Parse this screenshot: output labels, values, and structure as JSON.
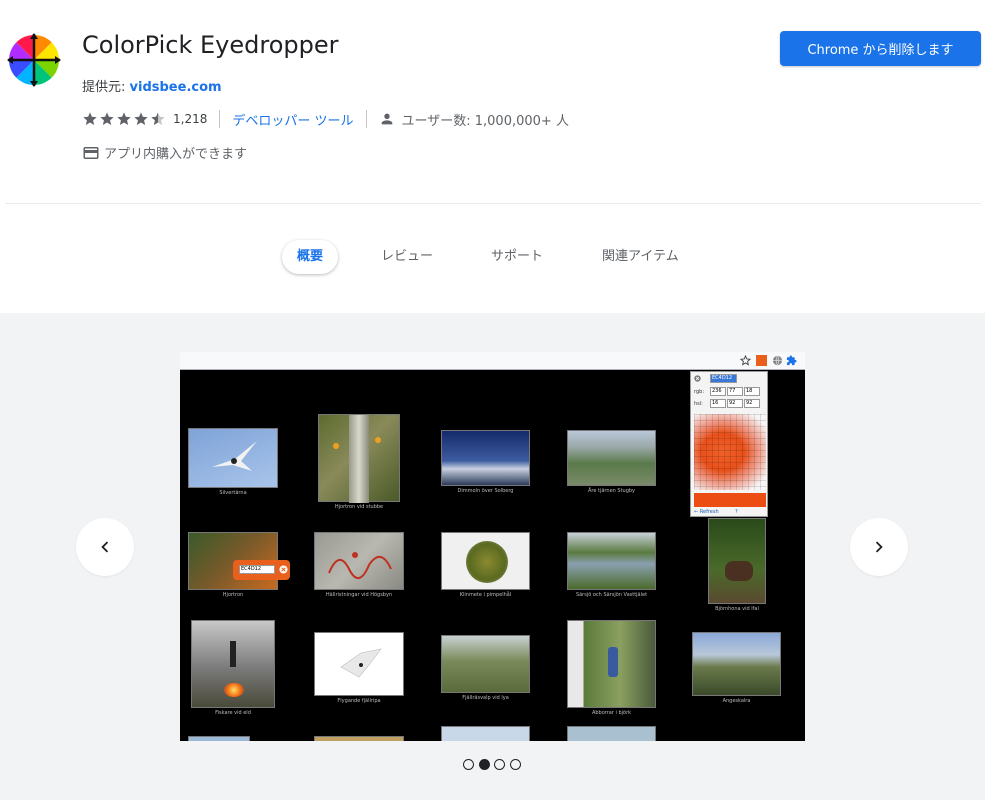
{
  "header": {
    "title": "ColorPick Eyedropper",
    "provider_label": "提供元:",
    "provider_name": "vidsbee.com",
    "rating_value": 4.5,
    "rating_count": "1,218",
    "category": "デベロッパー ツール",
    "users": "ユーザー数: 1,000,000+ 人",
    "purchases": "アプリ内購入ができます",
    "remove_button": "Chrome から削除します"
  },
  "tabs": [
    {
      "label": "概要",
      "active": true
    },
    {
      "label": "レビュー",
      "active": false
    },
    {
      "label": "サポート",
      "active": false
    },
    {
      "label": "関連アイテム",
      "active": false
    }
  ],
  "gallery": {
    "prev_icon": "chevron-left-icon",
    "next_icon": "chevron-right-icon",
    "slide_count": 4,
    "active_slide": 1,
    "screenshot": {
      "picker": {
        "hex": "EC4D12",
        "rgb_label": "rgb:",
        "rgb": [
          "236",
          "77",
          "18"
        ],
        "hsl_label": "hsl:",
        "hsl": [
          "16",
          "92",
          "92"
        ],
        "refresh": "← Refresh",
        "help": "?",
        "color": "#EC4D12"
      },
      "tooltip_hex": "EC4D12",
      "captions": [
        "Silvertärna",
        "Hjortron vid stubbe",
        "Dimmoln över Solberg",
        "Åre tjärnen Stugby",
        "Hjortron",
        "Hällristningar vid Högsbyn",
        "Klinmete i pimpelhål",
        "Särsjö och Särsjön Vasttjälet",
        "Björnhona vid lfal",
        "Fiskare vid eld",
        "Flygande fjällripa",
        "Fjällräsvalp vid lya",
        "Abborrar i björk",
        "Angeskalra"
      ]
    }
  },
  "colors": {
    "accent": "#1a73e8",
    "gallery_bg": "#f1f3f4"
  }
}
